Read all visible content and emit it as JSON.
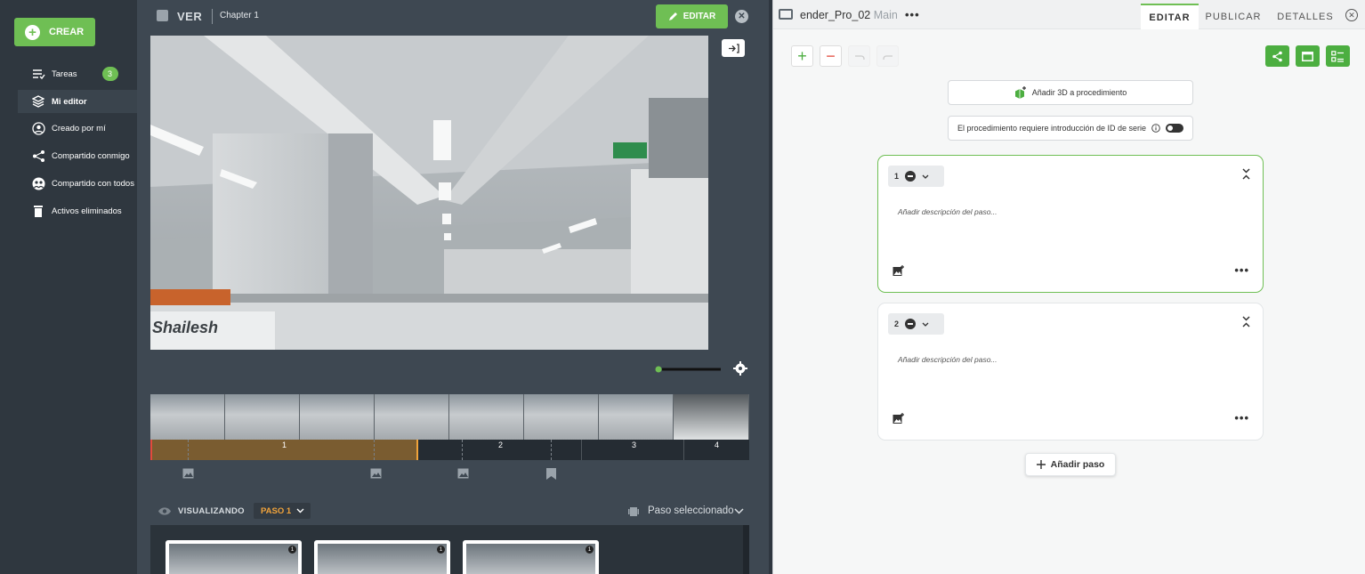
{
  "sidebar": {
    "create_label": "CREAR",
    "items": [
      {
        "label": "Tareas",
        "badge": "3",
        "icon": "tasks-icon"
      },
      {
        "label": "Mi editor",
        "icon": "layers-icon"
      },
      {
        "label": "Creado por mí",
        "icon": "user-circle-icon"
      },
      {
        "label": "Compartido conmigo",
        "icon": "share-icon"
      },
      {
        "label": "Compartido con todos",
        "icon": "globe-icon"
      },
      {
        "label": "Activos eliminados",
        "icon": "trash-icon"
      }
    ]
  },
  "viewer": {
    "mode_label": "VER",
    "chapter": "Chapter 1",
    "edit_label": "EDITAR",
    "video_text": "Shailesh",
    "timeline": {
      "segments": [
        "1",
        "2",
        "3",
        "4"
      ]
    },
    "visualizing_label": "VISUALIZANDO",
    "step_selector": "PASO 1",
    "selected_step_label": "Paso seleccionado",
    "step_cards": [
      {
        "badge": "1"
      },
      {
        "badge": "1"
      },
      {
        "badge": "1"
      }
    ]
  },
  "editor": {
    "file_name": "ender_Pro_02",
    "branch": "Main",
    "tabs": [
      "EDITAR",
      "PUBLICAR",
      "DETALLES"
    ],
    "add_3d_label": "Añadir 3D a procedimiento",
    "serial_id_label": "El procedimiento requiere introducción de ID de serie",
    "steps": [
      {
        "number": "1",
        "placeholder": "Añadir descripción del paso..."
      },
      {
        "number": "2",
        "placeholder": "Añadir descripción del paso..."
      }
    ],
    "add_step_label": "Añadir paso"
  },
  "colors": {
    "accent": "#6fbf54",
    "timeline_progress": "#7a5c30",
    "step_selector": "#f0a33b"
  }
}
